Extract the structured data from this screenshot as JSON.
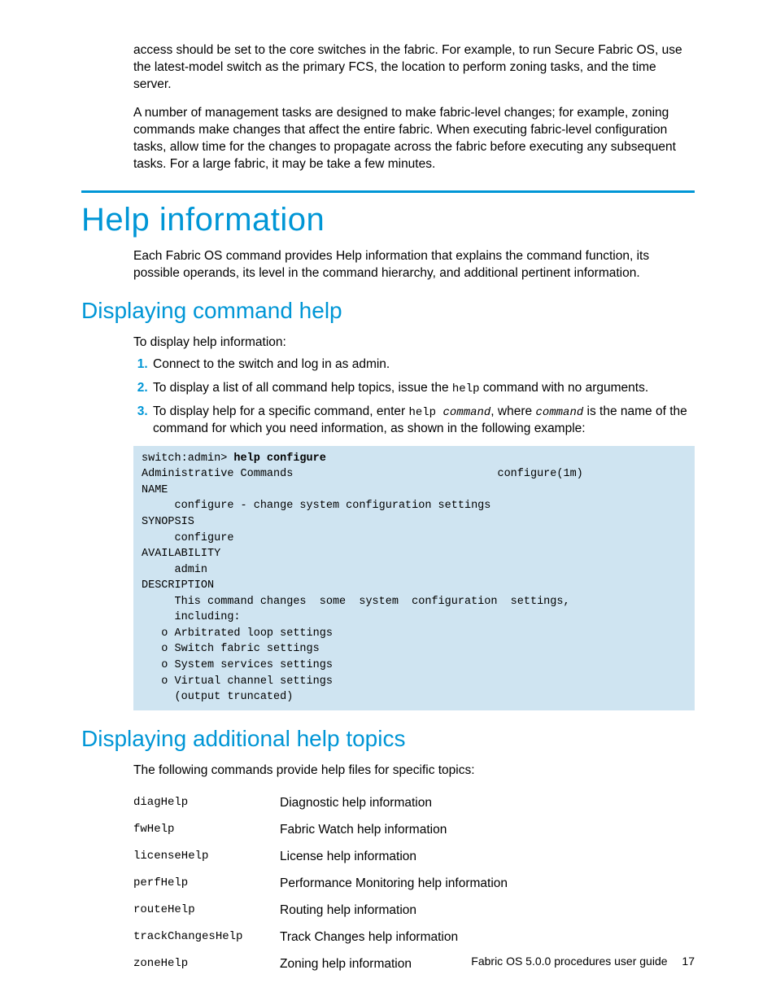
{
  "intro": {
    "p1": "access should be set to the core switches in the fabric. For example, to run Secure Fabric OS, use the latest-model switch as the primary FCS, the location to perform zoning tasks, and the time server.",
    "p2": "A number of management tasks are designed to make fabric-level changes; for example, zoning commands make changes that affect the entire fabric. When executing fabric-level configuration tasks, allow time for the changes to propagate across the fabric before executing any subsequent tasks. For a large fabric, it may be take a few minutes."
  },
  "help_info": {
    "title": "Help information",
    "p1": "Each Fabric OS command provides Help information that explains the command function, its possible operands, its level in the command hierarchy, and additional pertinent information."
  },
  "cmd_help": {
    "title": "Displaying command help",
    "intro": "To display help information:",
    "step1": "Connect to the switch and log in as admin.",
    "step2_a": "To display a list of all command help topics, issue the ",
    "step2_code": "help",
    "step2_b": " command with no arguments.",
    "step3_a": "To display help for a specific command, enter ",
    "step3_code1": "help ",
    "step3_code2": "command",
    "step3_b": ", where ",
    "step3_code3": "command",
    "step3_c": " is the name of the command for which you need information, as shown in the following example:",
    "code_prompt": "switch:admin> ",
    "code_cmd": "help configure",
    "code_body": "Administrative Commands                               configure(1m)\nNAME\n     configure - change system configuration settings\nSYNOPSIS\n     configure\nAVAILABILITY\n     admin\nDESCRIPTION\n     This command changes  some  system  configuration  settings,\n     including:\n   o Arbitrated loop settings\n   o Switch fabric settings\n   o System services settings\n   o Virtual channel settings\n     (output truncated)"
  },
  "add_help": {
    "title": "Displaying additional help topics",
    "intro": "The following commands provide help files for specific topics:",
    "rows": [
      {
        "cmd": "diagHelp",
        "desc": "Diagnostic help information"
      },
      {
        "cmd": "fwHelp",
        "desc": "Fabric Watch help information"
      },
      {
        "cmd": "licenseHelp",
        "desc": "License help information"
      },
      {
        "cmd": "perfHelp",
        "desc": "Performance Monitoring help information"
      },
      {
        "cmd": "routeHelp",
        "desc": "Routing help information"
      },
      {
        "cmd": "trackChangesHelp",
        "desc": "Track Changes help information"
      },
      {
        "cmd": "zoneHelp",
        "desc": "Zoning help information"
      }
    ]
  },
  "footer": {
    "text": "Fabric OS 5.0.0 procedures user guide",
    "page": "17"
  }
}
